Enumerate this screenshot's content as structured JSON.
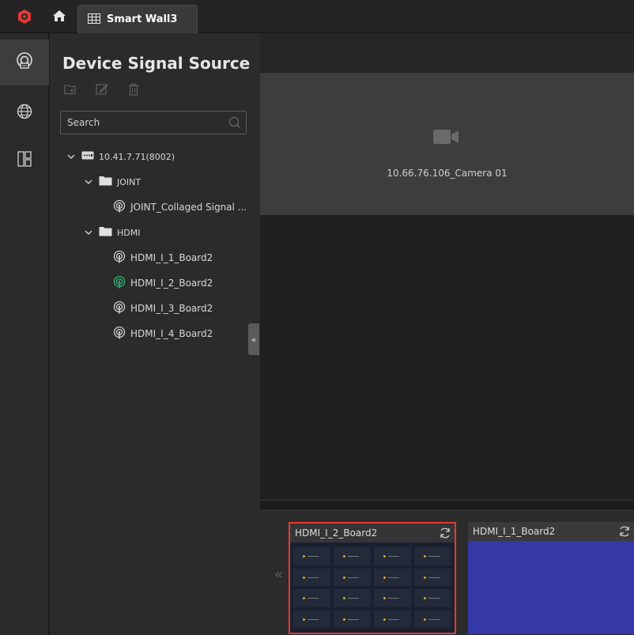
{
  "topbar": {
    "tab_label": "Smart Wall3",
    "icons": [
      "app-logo-icon",
      "home-icon",
      "video-wall-icon"
    ]
  },
  "rail": {
    "items": [
      {
        "name": "device-icon",
        "active": true
      },
      {
        "name": "globe-icon",
        "active": false
      },
      {
        "name": "layout-icon",
        "active": false
      }
    ]
  },
  "panel": {
    "title": "Device Signal Source",
    "tools": [
      "add-folder-icon",
      "edit-icon",
      "delete-icon"
    ],
    "search_placeholder": "Search"
  },
  "tree": {
    "device": "10.41.7.71(8002)",
    "group_joint": "JOINT",
    "joint_signal": "JOINT_Collaged Signal ...",
    "group_hdmi": "HDMI",
    "hdmi_1": "HDMI_I_1_Board2",
    "hdmi_2": "HDMI_I_2_Board2",
    "hdmi_3": "HDMI_I_3_Board2",
    "hdmi_4": "HDMI_I_4_Board2"
  },
  "main": {
    "camera_label": "10.66.76.106_Camera 01"
  },
  "previews": [
    {
      "label": "HDMI_I_2_Board2",
      "selected": true
    },
    {
      "label": "HDMI_I_1_Board2",
      "selected": false
    }
  ],
  "colors": {
    "accent_red": "#e53935",
    "active_signal_green": "#2bb673",
    "preview_blue": "#3539a8",
    "background": "#1e1e1e"
  }
}
